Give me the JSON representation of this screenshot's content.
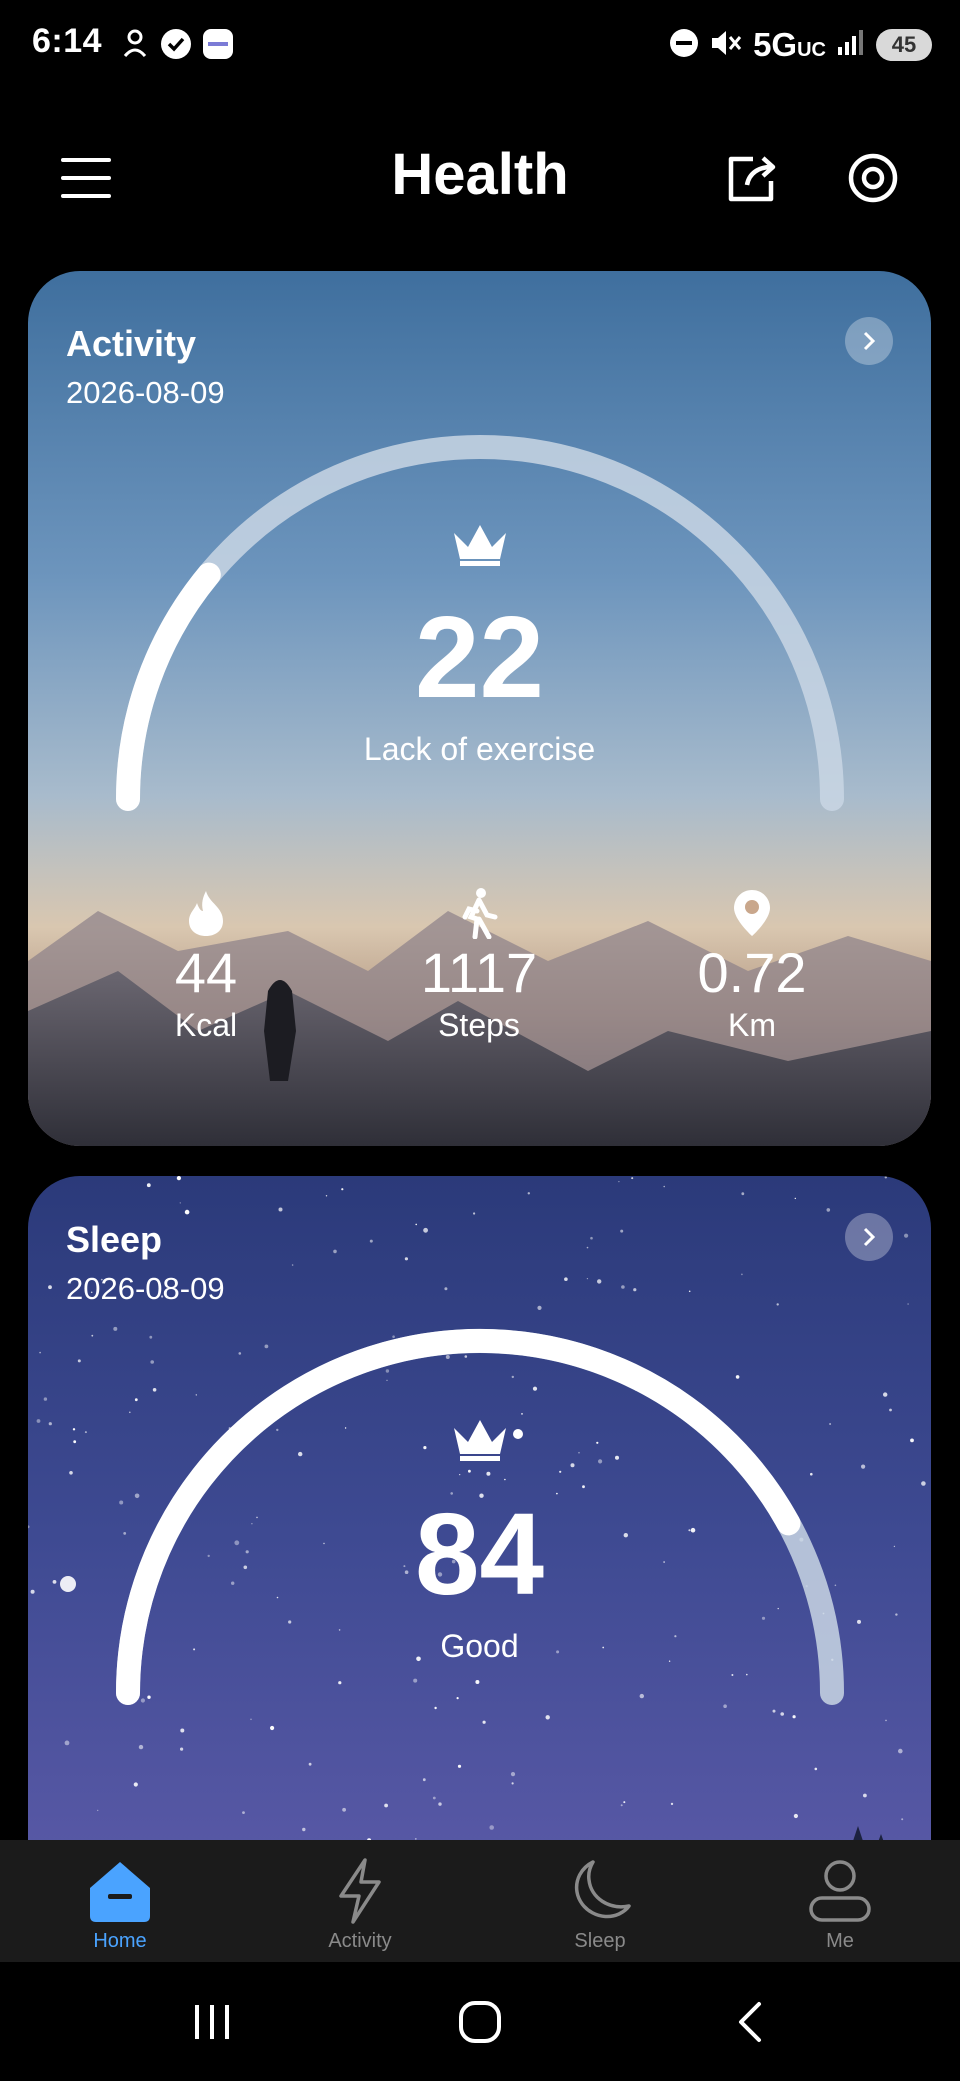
{
  "status_bar": {
    "time": "6:14",
    "network": "5G",
    "network_sub": "UC",
    "battery": "45"
  },
  "header": {
    "title": "Health",
    "icons": [
      "menu-icon",
      "share-icon",
      "target-icon"
    ]
  },
  "activity_card": {
    "title": "Activity",
    "date": "2026-08-09",
    "score": "22",
    "status": "Lack of exercise",
    "gauge_progress": 0.22,
    "metrics": [
      {
        "icon": "flame-icon",
        "value": "44",
        "unit": "Kcal"
      },
      {
        "icon": "walking-icon",
        "value": "1117",
        "unit": "Steps"
      },
      {
        "icon": "location-pin-icon",
        "value": "0.72",
        "unit": "Km"
      }
    ]
  },
  "sleep_card": {
    "title": "Sleep",
    "date": "2026-08-09",
    "score": "84",
    "status": "Good",
    "gauge_progress": 0.84
  },
  "bottom_nav": {
    "active": "Home",
    "items": [
      {
        "label": "Home",
        "icon": "home-icon"
      },
      {
        "label": "Activity",
        "icon": "lightning-icon"
      },
      {
        "label": "Sleep",
        "icon": "moon-icon"
      },
      {
        "label": "Me",
        "icon": "person-icon"
      }
    ]
  },
  "colors": {
    "accent": "#4aa3ff",
    "nav_background": "#1b1b1b",
    "gauge_track": "#c9d6e4"
  }
}
